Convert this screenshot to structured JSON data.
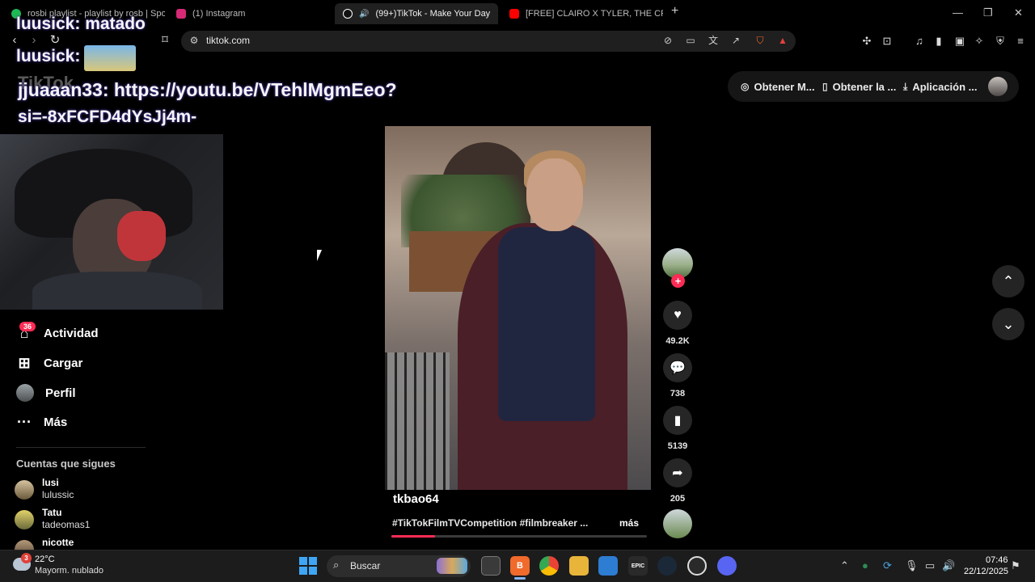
{
  "browser": {
    "tabs": [
      {
        "label": "rosbi playlist - playlist by rosb | Spoti",
        "color": "#1db954"
      },
      {
        "label": "(1) Instagram",
        "color": "#d62976"
      },
      {
        "label": "(99+)TikTok - Make Your Day",
        "color": "#ffffff"
      },
      {
        "label": "[FREE] CLAIRO X TYLER, THE CREATO",
        "color": "#ff0000"
      }
    ],
    "new_tab": "+",
    "url": "tiktok.com"
  },
  "stream_chat": {
    "line1": "luusick: matado",
    "line2": "luusick:",
    "line3": "jjuaaan33: https://youtu.be/VTehlMgmEeo?",
    "line4": "si=-8xFCFD4dYsJj4m-",
    "ghost_logo": "TikTok"
  },
  "sidebar": {
    "items": [
      {
        "label": "Actividad",
        "icon": "inbox-icon",
        "badge": "36"
      },
      {
        "label": "Cargar",
        "icon": "plus-square-icon"
      },
      {
        "label": "Perfil",
        "icon": "avatar-icon"
      },
      {
        "label": "Más",
        "icon": "more-dots-icon"
      }
    ],
    "following_title": "Cuentas que sigues",
    "following": [
      {
        "name": "lusi",
        "handle": "lulussic"
      },
      {
        "name": "Tatu",
        "handle": "tadeomas1"
      },
      {
        "name": "nicotte",
        "handle": ""
      }
    ]
  },
  "top_actions": {
    "coins": "Obtener M...",
    "app": "Obtener la ...",
    "desktop": "Aplicación ..."
  },
  "video": {
    "author": "tkbao64",
    "caption": "#TikTokFilmTVCompetition #filmbreaker ...",
    "more": "más",
    "progress": 0.17,
    "likes": "49.2K",
    "comments": "738",
    "saves": "5139",
    "shares": "205",
    "accent": "#fe2c55"
  },
  "taskbar": {
    "temp": "22°C",
    "weather": "Mayorm. nublado",
    "weather_badge": "3",
    "search": "Buscar",
    "time": "07:46",
    "date": "22/12/2025"
  }
}
